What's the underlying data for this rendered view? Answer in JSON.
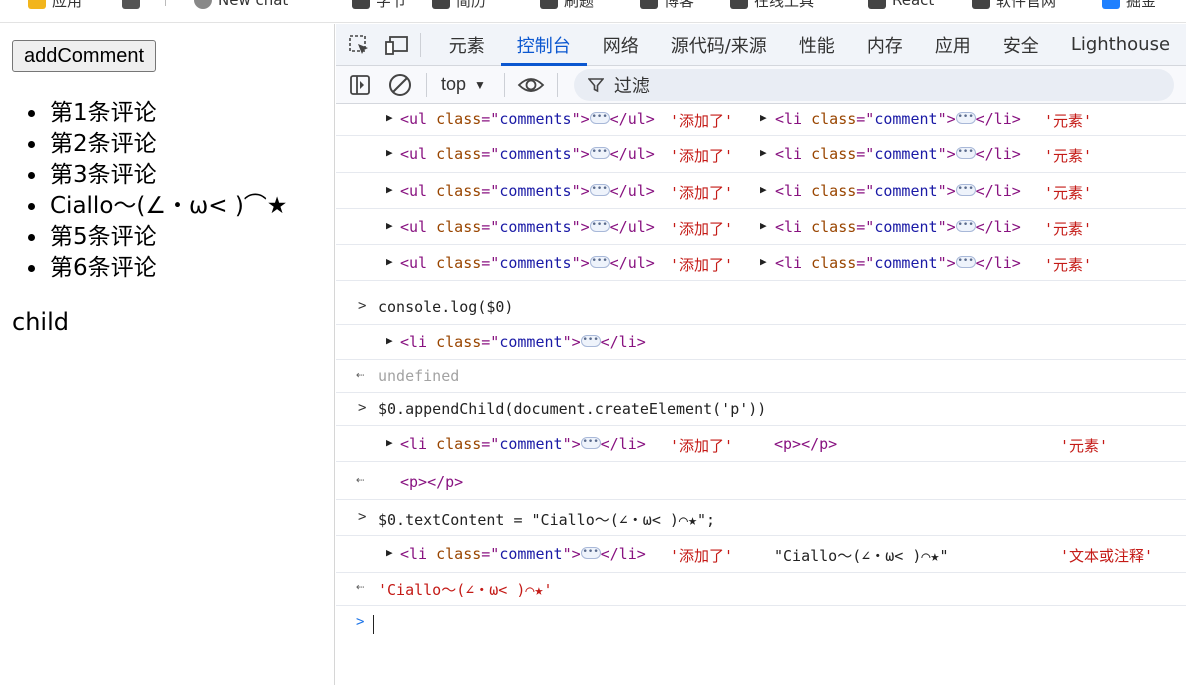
{
  "bookmarks": [
    {
      "label": "应用",
      "color": "#f2b51c"
    },
    {
      "label": "",
      "color": "#555555"
    },
    {
      "label": "New chat",
      "color": "#888888"
    },
    {
      "label": "字节",
      "color": "#444444"
    },
    {
      "label": "简历",
      "color": "#444444"
    },
    {
      "label": "刷题",
      "color": "#444444"
    },
    {
      "label": "博客",
      "color": "#444444"
    },
    {
      "label": "在线工具",
      "color": "#444444"
    },
    {
      "label": "React",
      "color": "#444444"
    },
    {
      "label": "软件官网",
      "color": "#444444"
    },
    {
      "label": "掘金",
      "color": "#1e80ff"
    }
  ],
  "page": {
    "button_label": "addComment",
    "comments": [
      "第1条评论",
      "第2条评论",
      "第3条评论",
      "Ciallo～(∠・ω< )⌒★",
      "第5条评论",
      "第6条评论"
    ],
    "child_text": "child"
  },
  "devtools": {
    "tabs": [
      "元素",
      "控制台",
      "网络",
      "源代码/来源",
      "性能",
      "内存",
      "应用",
      "安全",
      "Lighthouse"
    ],
    "active_tab": "控制台",
    "context": "top",
    "filter_label": "过滤",
    "accent": "#0b57d0",
    "console": {
      "ul_tag_open": "<ul",
      "ul_tag_close": "</ul>",
      "li_tag_open": "<li",
      "li_tag_close": "</li>",
      "class_attr": "class",
      "eq": "=\"",
      "class_comments": "comments",
      "class_comment": "comment",
      "close_quote": "\">",
      "added_str": "'添加了'",
      "element_str": "'元素'",
      "text_or_comment_str": "'文本或注释'",
      "cmd_log": "console.log($0)",
      "undefined": "undefined",
      "cmd_append": "$0.appendChild(document.createElement('p'))",
      "p_el": "<p></p>",
      "cmd_text": "$0.textContent = \"Ciallo～(∠・ω< )⌒★\";",
      "ciallo_dq": "\"Ciallo～(∠・ω< )⌒★\"",
      "ciallo_sq": "'Ciallo～(∠・ω< )⌒★'"
    }
  }
}
